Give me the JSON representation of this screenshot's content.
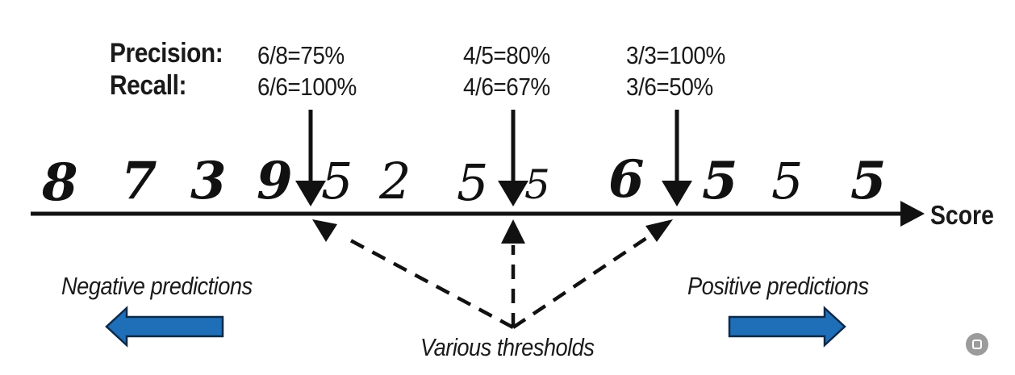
{
  "labels": {
    "precision": "Precision:",
    "recall": "Recall:",
    "score": "Score",
    "negative": "Negative predictions",
    "positive": "Positive predictions",
    "thresholds": "Various thresholds"
  },
  "thresholds": [
    {
      "precision": "6/8=75%",
      "recall": "6/6=100%"
    },
    {
      "precision": "4/5=80%",
      "recall": "4/6=67%"
    },
    {
      "precision": "3/3=100%",
      "recall": "3/6=50%"
    }
  ],
  "digits": [
    "8",
    "7",
    "3",
    "9",
    "5",
    "2",
    "5",
    "5",
    "6",
    "5",
    "5",
    "5"
  ],
  "colors": {
    "arrow_fill": "#1f6fb8",
    "arrow_stroke": "#0e2a4a",
    "ink": "#111111"
  }
}
